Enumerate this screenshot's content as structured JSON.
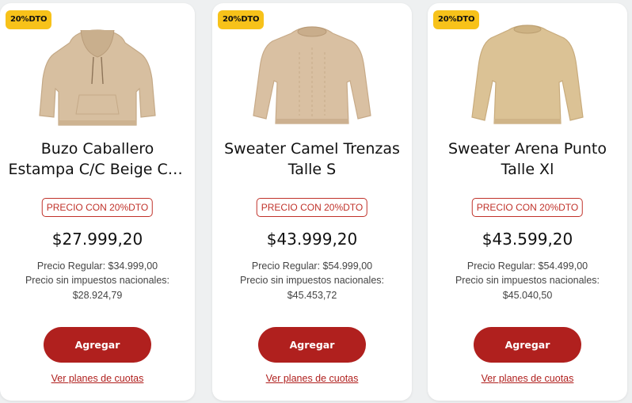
{
  "products": [
    {
      "badge": "20%DTO",
      "title": "Buzo Caballero Estampa C/C Beige Con Capucha",
      "promo_label": "PRECIO CON 20%DTO",
      "price": "$27.999,20",
      "regular_price": "Precio Regular: $34.999,00",
      "no_tax_label": "Precio sin impuestos nacionales:",
      "no_tax_value": "$28.924,79",
      "button_label": "Agregar",
      "installments_label": "Ver planes de cuotas",
      "image_icon": "hoodie-icon",
      "image_color": "#d7bfa0"
    },
    {
      "badge": "20%DTO",
      "title": "Sweater Camel Trenzas Talle S",
      "promo_label": "PRECIO CON 20%DTO",
      "price": "$43.999,20",
      "regular_price": "Precio Regular: $54.999,00",
      "no_tax_label": "Precio sin impuestos nacionales:",
      "no_tax_value": "$45.453,72",
      "button_label": "Agregar",
      "installments_label": "Ver planes de cuotas",
      "image_icon": "sweater-icon",
      "image_color": "#d9c0a2"
    },
    {
      "badge": "20%DTO",
      "title": "Sweater Arena Punto Talle Xl",
      "promo_label": "PRECIO CON 20%DTO",
      "price": "$43.599,20",
      "regular_price": "Precio Regular: $54.499,00",
      "no_tax_label": "Precio sin impuestos nacionales:",
      "no_tax_value": "$45.040,50",
      "button_label": "Agregar",
      "installments_label": "Ver planes de cuotas",
      "image_icon": "sweater-icon",
      "image_color": "#dbc295"
    }
  ]
}
